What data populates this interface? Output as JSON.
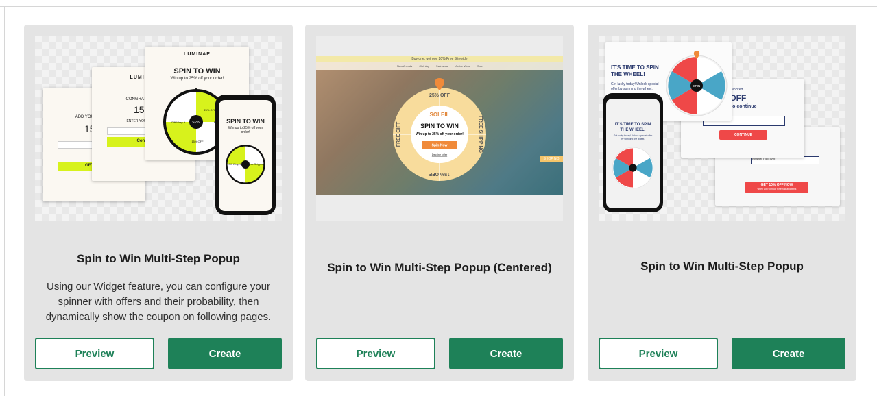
{
  "cards": [
    {
      "title": "Spin to Win Multi-Step Popup",
      "description": "Using our Widget feature, you can configure your spinner with offers and their probability, then dynamically show the coupon on following pages.",
      "preview_label": "Preview",
      "create_label": "Create",
      "thumbnail": {
        "brand": "LUMINAE",
        "step1_title": "ADD YOUR PHONE",
        "step1_value": "15%",
        "step1_button": "GET 15%",
        "step2_title": "CONGRATS! YOU'",
        "step2_value": "15%",
        "step2_label": "ENTER YOUR EMAIL",
        "step2_button": "Contin",
        "step3_title": "SPIN TO WIN",
        "step3_subtitle": "Win up to 25% off your order!",
        "wheel_center": "SPIN",
        "wheel_segments": [
          "25% OFF",
          "Free",
          "15% OFF",
          "Gift Wrap It"
        ],
        "phone_title": "SPIN TO WIN",
        "phone_subtitle": "Win up to 25% off your order!",
        "phone_segments": [
          "Gift Wrap It",
          "Free Shipping"
        ]
      }
    },
    {
      "title": "Spin to Win Multi-Step Popup (Centered)",
      "preview_label": "Preview",
      "create_label": "Create",
      "thumbnail": {
        "banner_text": "Buy one, get one 20% Free Sitewide",
        "nav_items": [
          "New Arrivals",
          "Clothing",
          "Swimwear",
          "Active Wear",
          "Sale"
        ],
        "brand": "SOLEIL",
        "segments": [
          "25% OFF",
          "FREE SHIPPING",
          "15% OFF",
          "FREE GIFT"
        ],
        "title": "SPIN TO WIN",
        "subtitle": "Win up to 25% off your order!",
        "button": "Spin Now",
        "decline": "Decline offer",
        "side_button": "SHOP NO"
      }
    },
    {
      "title": "Spin to Win Multi-Step Popup",
      "preview_label": "Preview",
      "create_label": "Create",
      "thumbnail": {
        "step1_title": "IT'S TIME TO SPIN THE WHEEL!",
        "step1_body": "Get lucky today! Unlock special offer by spinning the wheel.",
        "wheel_center": "SPIN",
        "step2_kicker": "ats! You've Unlocked",
        "step2_value": "10% OFF",
        "step2_body": "ur email to continue",
        "email_placeholder": "Email address",
        "continue_button": "CONTINUE",
        "mobile_placeholder": "Mobile Number",
        "step3_button": "GET 10% OFF NOW",
        "step3_sub": "when you sign up for email and texts",
        "phone_title": "IT'S TIME TO SPIN THE WHEEL!",
        "phone_body": "Get lucky today! Unlock special offer by spinning the wheel."
      }
    }
  ]
}
